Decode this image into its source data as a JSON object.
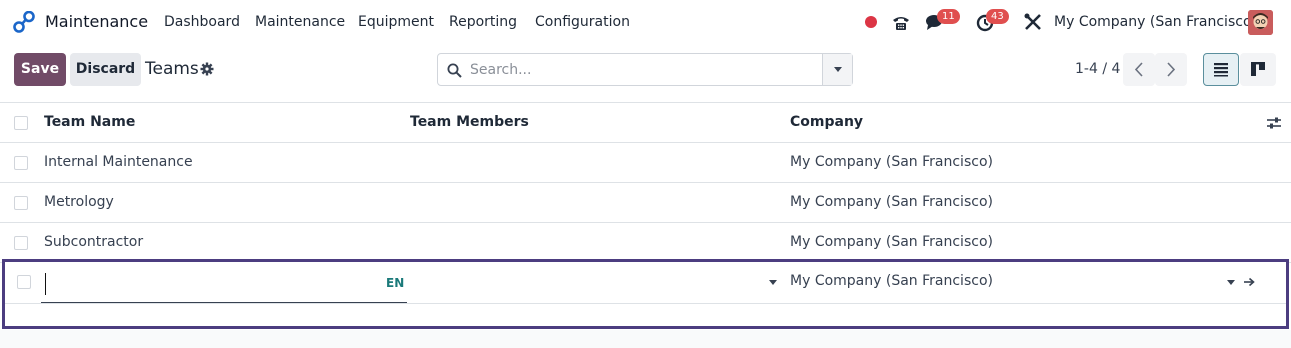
{
  "app": {
    "name": "Maintenance",
    "brand_icon": "odoo-logo-icon"
  },
  "nav": {
    "items": [
      "Dashboard",
      "Maintenance",
      "Equipment",
      "Reporting",
      "Configuration"
    ]
  },
  "systray": {
    "status_dot_color": "#dc3545",
    "phone_icon": "phone-icon",
    "messages_icon": "chat-icon",
    "messages_count": "11",
    "activities_icon": "clock-icon",
    "activities_count": "43",
    "tools_icon": "tools-icon",
    "company": "My Company (San Francisco)",
    "avatar_icon": "user-avatar-icon"
  },
  "control_panel": {
    "save_label": "Save",
    "discard_label": "Discard",
    "title": "Teams",
    "search_placeholder": "Search...",
    "pager": "1-4 / 4"
  },
  "colors": {
    "primary": "#714b67",
    "edit_border": "#4c3d80",
    "badge": "#e04f4f",
    "lang_tag": "#1b7a7a"
  },
  "table": {
    "headers": [
      "Team Name",
      "Team Members",
      "Company"
    ],
    "rows": [
      {
        "name": "Internal Maintenance",
        "members": "",
        "company": "My Company (San Francisco)"
      },
      {
        "name": "Metrology",
        "members": "",
        "company": "My Company (San Francisco)"
      },
      {
        "name": "Subcontractor",
        "members": "",
        "company": "My Company (San Francisco)"
      }
    ],
    "edit_row": {
      "name_value": "",
      "lang": "EN",
      "company": "My Company (San Francisco)"
    }
  }
}
